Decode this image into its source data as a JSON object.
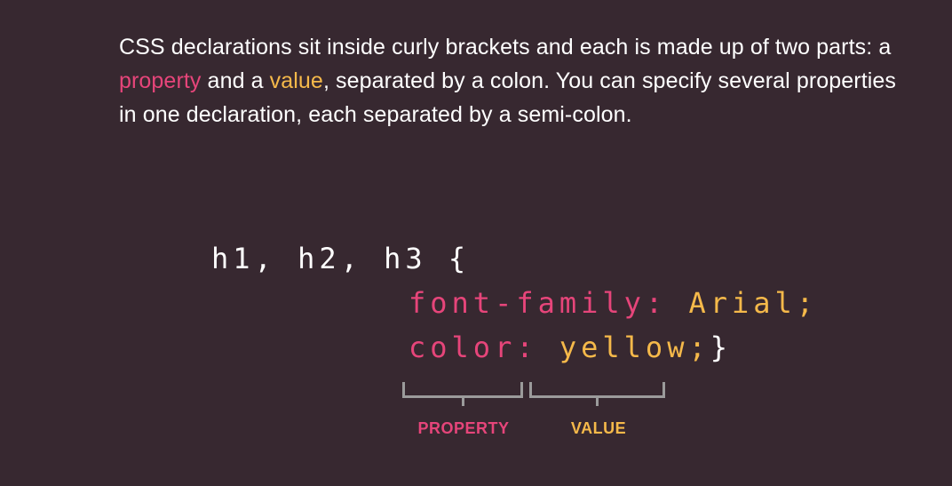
{
  "intro": {
    "part1": "CSS declarations sit inside curly brackets and each is made up of two parts: a ",
    "property_word": "property",
    "part2": " and a ",
    "value_word": "value",
    "part3": ", separated by a colon. You can specify several properties in one declaration, each separated by a semi-colon."
  },
  "code": {
    "selector_line": "h1, h2, h3 {",
    "decl1_property": "font-family:",
    "decl1_value": " Arial;",
    "decl2_property": "color:",
    "decl2_value": " yellow;",
    "closing_brace": "}"
  },
  "labels": {
    "property": "PROPERTY",
    "value": "VALUE"
  },
  "colors": {
    "background": "#372830",
    "property": "#e6457a",
    "value": "#f5b94a",
    "bracket": "#9b9b9b",
    "text": "#ffffff"
  }
}
